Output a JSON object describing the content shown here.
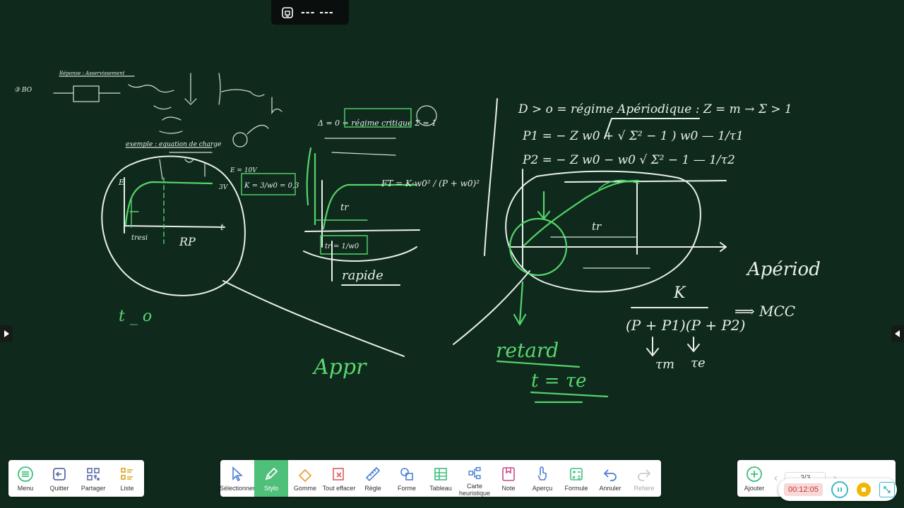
{
  "top_tab": {
    "text": "--- ---",
    "icon": "presentation-icon"
  },
  "board": {
    "background": "#0f2a1d",
    "annotations": {
      "t0": "t _ o",
      "appr": "Appr",
      "rapide": "rapide",
      "retard": "retard",
      "t_equals_tau": "t = τe",
      "D_line": "D > o  =  régime Apériodique : Z = m → Σ > 1",
      "P1_line": "P1 = − Z w0 + √ Σ² − 1 ) w0  —  1/τ1",
      "P2_line": "P2 = − Z w0 − w0 √ Σ² − 1  —  1/τ2",
      "K_frac_num": "K",
      "K_frac_den": "(P + P1)(P + P2)",
      "tau_m": "τm",
      "tau_e": "τe",
      "tr": "tr",
      "apriodique": "Apériod",
      "mcc": "⟹  MCC",
      "RP": "RP",
      "E": "E",
      "delta_line": "Δ = 0 = régime critique  Σ = 1",
      "FT": "FT = K·w0² / (P + w0)²",
      "K_box": "K = 3/w0 = 0,3",
      "exemple": "exemple : equation de charge",
      "voltage_3v": "3V",
      "e10v": "E = 10V",
      "tr_box": "tr = 1/w0",
      "reponse": "Réponse : Asservissement",
      "bo": "③ BO"
    }
  },
  "left_bar": {
    "buttons": [
      {
        "label": "Menu",
        "icon": "menu-icon"
      },
      {
        "label": "Quitter",
        "icon": "exit-icon"
      },
      {
        "label": "Partager",
        "icon": "qr-share-icon"
      },
      {
        "label": "Liste",
        "icon": "list-icon"
      }
    ]
  },
  "tool_bar": {
    "buttons": [
      {
        "label": "Sélectionner",
        "icon": "cursor-icon"
      },
      {
        "label": "Stylo",
        "icon": "pen-icon"
      },
      {
        "label": "Gomme",
        "icon": "eraser-icon"
      },
      {
        "label": "Tout effacer",
        "icon": "clear-all-icon"
      },
      {
        "label": "Règle",
        "icon": "ruler-icon"
      },
      {
        "label": "Forme",
        "icon": "shapes-icon"
      },
      {
        "label": "Tableau",
        "icon": "table-icon"
      },
      {
        "label": "Carte heuristique",
        "icon": "mindmap-icon"
      },
      {
        "label": "Note",
        "icon": "note-icon"
      },
      {
        "label": "Aperçu",
        "icon": "preview-icon"
      },
      {
        "label": "Formule",
        "icon": "formula-icon"
      },
      {
        "label": "Annuler",
        "icon": "undo-icon"
      },
      {
        "label": "Refaire",
        "icon": "redo-icon"
      }
    ],
    "active": "Stylo",
    "accent": "#4fc07a"
  },
  "right_bar": {
    "add_label": "Ajouter",
    "page_indicator": "3/3"
  },
  "recording": {
    "time": "00:12:05",
    "time_color": "#c9342f",
    "pause_color": "#3bb6c9",
    "stop_color": "#f2b705"
  }
}
